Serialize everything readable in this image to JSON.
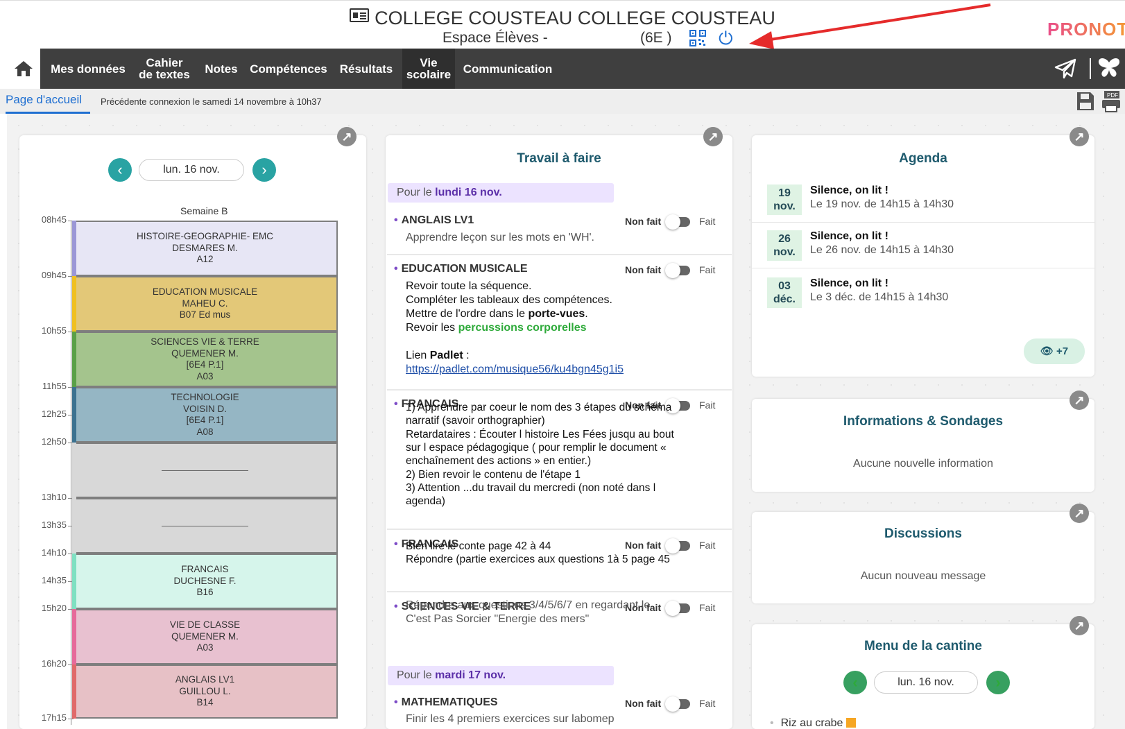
{
  "header": {
    "title": "COLLEGE COUSTEAU COLLEGE COUSTEAU",
    "subtitle_left": "Espace Élèves -",
    "subtitle_class": "(6E   )",
    "brand": "PRONOTE"
  },
  "nav": {
    "items": [
      {
        "label": "Mes données"
      },
      {
        "label": "Cahier\nde textes"
      },
      {
        "label": "Notes"
      },
      {
        "label": "Compétences"
      },
      {
        "label": "Résultats"
      },
      {
        "label": "Vie\nscolaire"
      },
      {
        "label": "Communication"
      }
    ]
  },
  "subbar": {
    "tab": "Page d'accueil",
    "previous_connection": "Précédente connexion le samedi 14 novembre à 10h37"
  },
  "schedule": {
    "date": "lun. 16 nov.",
    "week": "Semaine B",
    "times": [
      "08h45",
      "09h45",
      "10h55",
      "11h55",
      "12h25",
      "12h50",
      "13h10",
      "13h35",
      "14h10",
      "14h35",
      "15h20",
      "16h20",
      "17h15"
    ],
    "slots": [
      {
        "lines": [
          "HISTOIRE-GEOGRAPHIE- EMC",
          "DESMARES M.",
          "A12"
        ],
        "color": "#e7e6f5",
        "bar": "#9b97d6"
      },
      {
        "lines": [
          "EDUCATION MUSICALE",
          "MAHEU C.",
          "B07 Ed mus"
        ],
        "color": "#e3c878",
        "bar": "#f0c020"
      },
      {
        "lines": [
          "SCIENCES VIE & TERRE",
          "QUEMENER M.",
          "[6E4 P.1]",
          "A03"
        ],
        "color": "#a4c48d",
        "bar": "#5aa048"
      },
      {
        "lines": [
          "TECHNOLOGIE",
          "VOISIN D.",
          "[6E4 P.1]",
          "A08"
        ],
        "color": "#95b6c4",
        "bar": "#3c7290"
      },
      {
        "lines": [],
        "color": "#d8d8d8",
        "bar": "#d8d8d8"
      },
      {
        "lines": [],
        "color": "#d8d8d8",
        "bar": "#d8d8d8"
      },
      {
        "lines": [
          "FRANCAIS",
          "DUCHESNE F.",
          "B16"
        ],
        "color": "#d6f5eb",
        "bar": "#7fe0c2"
      },
      {
        "lines": [
          "VIE DE CLASSE",
          "QUEMENER M.",
          "A03"
        ],
        "color": "#e8c1d0",
        "bar": "#e66a9a"
      },
      {
        "lines": [
          "ANGLAIS LV1",
          "GUILLOU L.",
          "B14"
        ],
        "color": "#e7c1c6",
        "bar": "#e06a6a"
      }
    ]
  },
  "homework": {
    "title": "Travail à faire",
    "day1": {
      "pre": "Pour le",
      "day": "lundi 16 nov."
    },
    "day2": {
      "pre": "Pour le",
      "day": "mardi 17 nov."
    },
    "status_not_done": "Non fait",
    "status_done": "Fait",
    "tasks": [
      {
        "subject": "ANGLAIS LV1",
        "text": "Apprendre leçon sur les mots en 'WH'."
      },
      {
        "subject": "EDUCATION MUSICALE",
        "l1": "Revoir toute la séquence.",
        "l2": "Compléter les tableaux des compétences.",
        "l3a": "Mettre de l'ordre dans le ",
        "l3b": "porte-vues",
        "l3c": ".",
        "l4a": "Revoir les ",
        "l4b": "percussions corporelles",
        "l5a": "Lien ",
        "l5b": "Padlet",
        "l5c": " :",
        "link": "https://padlet.com/musique56/ku4bgn45g1i5"
      },
      {
        "subject": "FRANCAIS",
        "lines": [
          "1) Apprendre par coeur le nom des 3 étapes du schéma",
          "narratif (savoir orthographier)",
          "Retardataires : Écouter l histoire Les Fées  jusqu au bout",
          "sur l espace pédagogique ( pour remplir le document «",
          "enchaînement des actions » en entier.)",
          "2) Bien revoir le contenu de l'étape 1",
          "3) Attention ...du travail du mercredi (non noté dans l",
          "agenda)"
        ]
      },
      {
        "subject": "FRANCAIS",
        "lines": [
          "Bien lire le conte page 42 à 44",
          "Répondre (partie exercices aux questions 1à 5 page 45"
        ]
      },
      {
        "subject": "SCIENCES VIE & TERRE",
        "lines": [
          "Répondre aux questions 3/4/5/6/7 en regardant le",
          "C'est Pas Sorcier \"Energie des mers\""
        ]
      },
      {
        "subject": "MATHEMATIQUES",
        "text": "Finir les 4 premiers exercices sur labomep"
      }
    ]
  },
  "agenda": {
    "title": "Agenda",
    "items": [
      {
        "day": "19",
        "month": "nov.",
        "title": "Silence, on lit !",
        "text": "Le 19 nov. de 14h15 à 14h30"
      },
      {
        "day": "26",
        "month": "nov.",
        "title": "Silence, on lit !",
        "text": "Le 26 nov. de 14h15 à 14h30"
      },
      {
        "day": "03",
        "month": "déc.",
        "title": "Silence, on lit !",
        "text": "Le 3 déc. de 14h15 à 14h30"
      }
    ],
    "more": "+7"
  },
  "info": {
    "title": "Informations & Sondages",
    "empty": "Aucune nouvelle information"
  },
  "discussions": {
    "title": "Discussions",
    "empty": "Aucun nouveau message"
  },
  "canteen": {
    "title": "Menu de la cantine",
    "date": "lun. 16 nov.",
    "item": "Riz au crabe"
  },
  "colors": {
    "nav": "#3f3f3f",
    "accent_blue": "#1f6fd1",
    "teal": "#29a3a3",
    "title": "#1e5a6d"
  }
}
